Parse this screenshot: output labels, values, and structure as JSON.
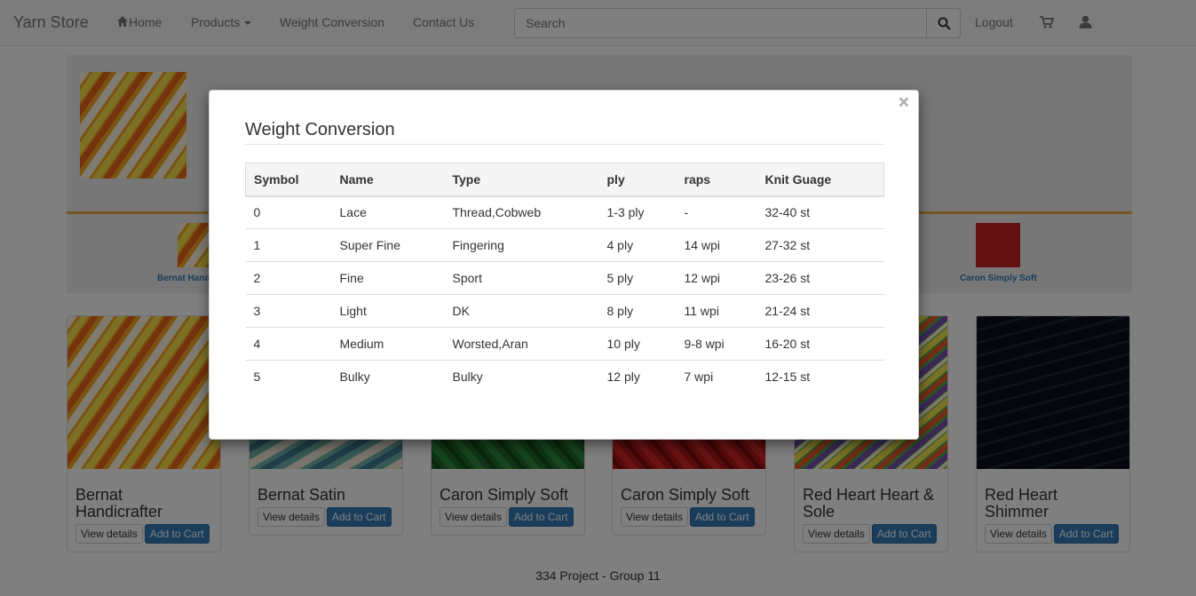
{
  "navbar": {
    "brand": "Yarn Store",
    "home": "Home",
    "products": "Products",
    "weight_conversion": "Weight Conversion",
    "contact": "Contact Us",
    "search_placeholder": "Search",
    "logout": "Logout"
  },
  "carousel": {
    "thumb_labels": [
      "Bernat Handi",
      "Caron Simply Soft"
    ]
  },
  "products": [
    {
      "name": "Bernat Handicrafter",
      "view": "View details",
      "add": "Add to Cart"
    },
    {
      "name": "Bernat Satin",
      "view": "View details",
      "add": "Add to Cart"
    },
    {
      "name": "Caron Simply Soft",
      "view": "View details",
      "add": "Add to Cart"
    },
    {
      "name": "Caron Simply Soft",
      "view": "View details",
      "add": "Add to Cart"
    },
    {
      "name": "Red Heart Heart & Sole",
      "view": "View details",
      "add": "Add to Cart"
    },
    {
      "name": "Red Heart Shimmer",
      "view": "View details",
      "add": "Add to Cart"
    }
  ],
  "footer": "334 Project - Group 11",
  "modal": {
    "close": "×",
    "title": "Weight Conversion",
    "columns": [
      "Symbol",
      "Name",
      "Type",
      "ply",
      "raps",
      "Knit Guage"
    ],
    "rows": [
      [
        "0",
        "Lace",
        "Thread,Cobweb",
        "1-3 ply",
        "-",
        "32-40 st"
      ],
      [
        "1",
        "Super Fine",
        "Fingering",
        "4 ply",
        "14 wpi",
        "27-32 st"
      ],
      [
        "2",
        "Fine",
        "Sport",
        "5 ply",
        "12 wpi",
        "23-26 st"
      ],
      [
        "3",
        "Light",
        "DK",
        "8 ply",
        "11 wpi",
        "21-24 st"
      ],
      [
        "4",
        "Medium",
        "Worsted,Aran",
        "10 ply",
        "9-8 wpi",
        "16-20 st"
      ],
      [
        "5",
        "Bulky",
        "Bulky",
        "12 ply",
        "7 wpi",
        "12-15 st"
      ]
    ]
  },
  "icons": {
    "home": "home-icon",
    "search": "search-icon",
    "cart": "cart-icon",
    "user": "user-icon",
    "close": "close-icon"
  },
  "colors": {
    "primary": "#337ab7",
    "accent": "#f0ad4e",
    "backdrop": "rgba(0,0,0,0.5)"
  }
}
